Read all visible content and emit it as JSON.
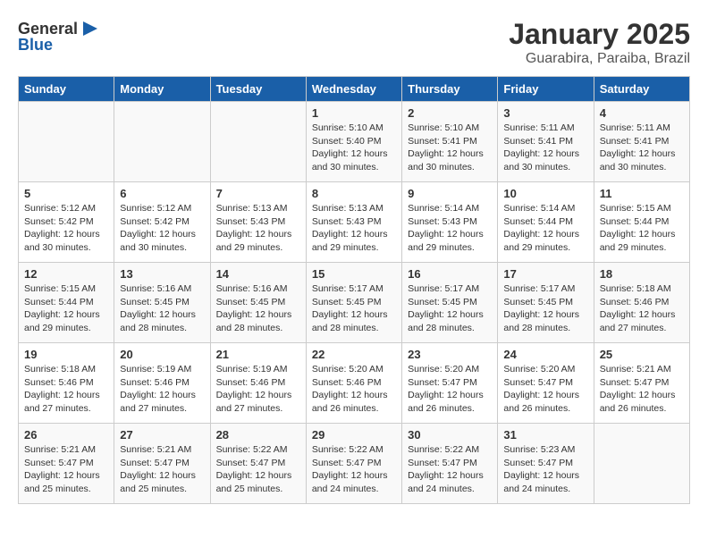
{
  "header": {
    "logo_general": "General",
    "logo_blue": "Blue",
    "month_title": "January 2025",
    "location": "Guarabira, Paraiba, Brazil"
  },
  "days_of_week": [
    "Sunday",
    "Monday",
    "Tuesday",
    "Wednesday",
    "Thursday",
    "Friday",
    "Saturday"
  ],
  "weeks": [
    [
      {
        "day": "",
        "info": ""
      },
      {
        "day": "",
        "info": ""
      },
      {
        "day": "",
        "info": ""
      },
      {
        "day": "1",
        "info": "Sunrise: 5:10 AM\nSunset: 5:40 PM\nDaylight: 12 hours\nand 30 minutes."
      },
      {
        "day": "2",
        "info": "Sunrise: 5:10 AM\nSunset: 5:41 PM\nDaylight: 12 hours\nand 30 minutes."
      },
      {
        "day": "3",
        "info": "Sunrise: 5:11 AM\nSunset: 5:41 PM\nDaylight: 12 hours\nand 30 minutes."
      },
      {
        "day": "4",
        "info": "Sunrise: 5:11 AM\nSunset: 5:41 PM\nDaylight: 12 hours\nand 30 minutes."
      }
    ],
    [
      {
        "day": "5",
        "info": "Sunrise: 5:12 AM\nSunset: 5:42 PM\nDaylight: 12 hours\nand 30 minutes."
      },
      {
        "day": "6",
        "info": "Sunrise: 5:12 AM\nSunset: 5:42 PM\nDaylight: 12 hours\nand 30 minutes."
      },
      {
        "day": "7",
        "info": "Sunrise: 5:13 AM\nSunset: 5:43 PM\nDaylight: 12 hours\nand 29 minutes."
      },
      {
        "day": "8",
        "info": "Sunrise: 5:13 AM\nSunset: 5:43 PM\nDaylight: 12 hours\nand 29 minutes."
      },
      {
        "day": "9",
        "info": "Sunrise: 5:14 AM\nSunset: 5:43 PM\nDaylight: 12 hours\nand 29 minutes."
      },
      {
        "day": "10",
        "info": "Sunrise: 5:14 AM\nSunset: 5:44 PM\nDaylight: 12 hours\nand 29 minutes."
      },
      {
        "day": "11",
        "info": "Sunrise: 5:15 AM\nSunset: 5:44 PM\nDaylight: 12 hours\nand 29 minutes."
      }
    ],
    [
      {
        "day": "12",
        "info": "Sunrise: 5:15 AM\nSunset: 5:44 PM\nDaylight: 12 hours\nand 29 minutes."
      },
      {
        "day": "13",
        "info": "Sunrise: 5:16 AM\nSunset: 5:45 PM\nDaylight: 12 hours\nand 28 minutes."
      },
      {
        "day": "14",
        "info": "Sunrise: 5:16 AM\nSunset: 5:45 PM\nDaylight: 12 hours\nand 28 minutes."
      },
      {
        "day": "15",
        "info": "Sunrise: 5:17 AM\nSunset: 5:45 PM\nDaylight: 12 hours\nand 28 minutes."
      },
      {
        "day": "16",
        "info": "Sunrise: 5:17 AM\nSunset: 5:45 PM\nDaylight: 12 hours\nand 28 minutes."
      },
      {
        "day": "17",
        "info": "Sunrise: 5:17 AM\nSunset: 5:45 PM\nDaylight: 12 hours\nand 28 minutes."
      },
      {
        "day": "18",
        "info": "Sunrise: 5:18 AM\nSunset: 5:46 PM\nDaylight: 12 hours\nand 27 minutes."
      }
    ],
    [
      {
        "day": "19",
        "info": "Sunrise: 5:18 AM\nSunset: 5:46 PM\nDaylight: 12 hours\nand 27 minutes."
      },
      {
        "day": "20",
        "info": "Sunrise: 5:19 AM\nSunset: 5:46 PM\nDaylight: 12 hours\nand 27 minutes."
      },
      {
        "day": "21",
        "info": "Sunrise: 5:19 AM\nSunset: 5:46 PM\nDaylight: 12 hours\nand 27 minutes."
      },
      {
        "day": "22",
        "info": "Sunrise: 5:20 AM\nSunset: 5:46 PM\nDaylight: 12 hours\nand 26 minutes."
      },
      {
        "day": "23",
        "info": "Sunrise: 5:20 AM\nSunset: 5:47 PM\nDaylight: 12 hours\nand 26 minutes."
      },
      {
        "day": "24",
        "info": "Sunrise: 5:20 AM\nSunset: 5:47 PM\nDaylight: 12 hours\nand 26 minutes."
      },
      {
        "day": "25",
        "info": "Sunrise: 5:21 AM\nSunset: 5:47 PM\nDaylight: 12 hours\nand 26 minutes."
      }
    ],
    [
      {
        "day": "26",
        "info": "Sunrise: 5:21 AM\nSunset: 5:47 PM\nDaylight: 12 hours\nand 25 minutes."
      },
      {
        "day": "27",
        "info": "Sunrise: 5:21 AM\nSunset: 5:47 PM\nDaylight: 12 hours\nand 25 minutes."
      },
      {
        "day": "28",
        "info": "Sunrise: 5:22 AM\nSunset: 5:47 PM\nDaylight: 12 hours\nand 25 minutes."
      },
      {
        "day": "29",
        "info": "Sunrise: 5:22 AM\nSunset: 5:47 PM\nDaylight: 12 hours\nand 24 minutes."
      },
      {
        "day": "30",
        "info": "Sunrise: 5:22 AM\nSunset: 5:47 PM\nDaylight: 12 hours\nand 24 minutes."
      },
      {
        "day": "31",
        "info": "Sunrise: 5:23 AM\nSunset: 5:47 PM\nDaylight: 12 hours\nand 24 minutes."
      },
      {
        "day": "",
        "info": ""
      }
    ]
  ]
}
